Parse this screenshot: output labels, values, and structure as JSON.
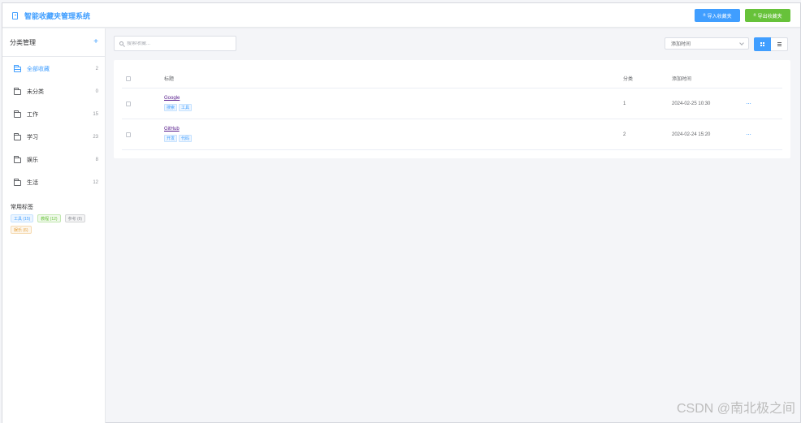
{
  "header": {
    "title": "智能收藏夹管理系统",
    "import_label": "导入收藏夹",
    "export_label": "导出收藏夹",
    "colors": {
      "primary": "#409eff",
      "success": "#67c23a"
    }
  },
  "sidebar": {
    "title": "分类管理",
    "add_symbol": "+",
    "categories": [
      {
        "label": "全部收藏",
        "count": "2",
        "active": true
      },
      {
        "label": "未分类",
        "count": "0"
      },
      {
        "label": "工作",
        "count": "15"
      },
      {
        "label": "学习",
        "count": "23"
      },
      {
        "label": "娱乐",
        "count": "8"
      },
      {
        "label": "生活",
        "count": "12"
      }
    ],
    "tags_title": "常用标签",
    "tags": [
      {
        "label": "工具 (15)",
        "color": "blue"
      },
      {
        "label": "教程 (12)",
        "color": "green"
      },
      {
        "label": "参考 (8)",
        "color": "gray"
      },
      {
        "label": "娱乐 (6)",
        "color": "orange"
      }
    ]
  },
  "toolbar": {
    "search_placeholder": "搜索收藏...",
    "sort_value": "添加时间",
    "view_modes": [
      "grid-icon",
      "list-icon"
    ]
  },
  "table": {
    "columns": {
      "title": "标题",
      "category": "分类",
      "added": "添加时间"
    },
    "rows": [
      {
        "title": "Google",
        "tags": [
          "搜索",
          "工具"
        ],
        "category": "1",
        "added": "2024-02-25 10:30",
        "more": "···"
      },
      {
        "title": "GitHub",
        "tags": [
          "开发",
          "代码"
        ],
        "category": "2",
        "added": "2024-02-24 15:20",
        "more": "···"
      }
    ]
  },
  "watermark": "CSDN @南北极之间"
}
